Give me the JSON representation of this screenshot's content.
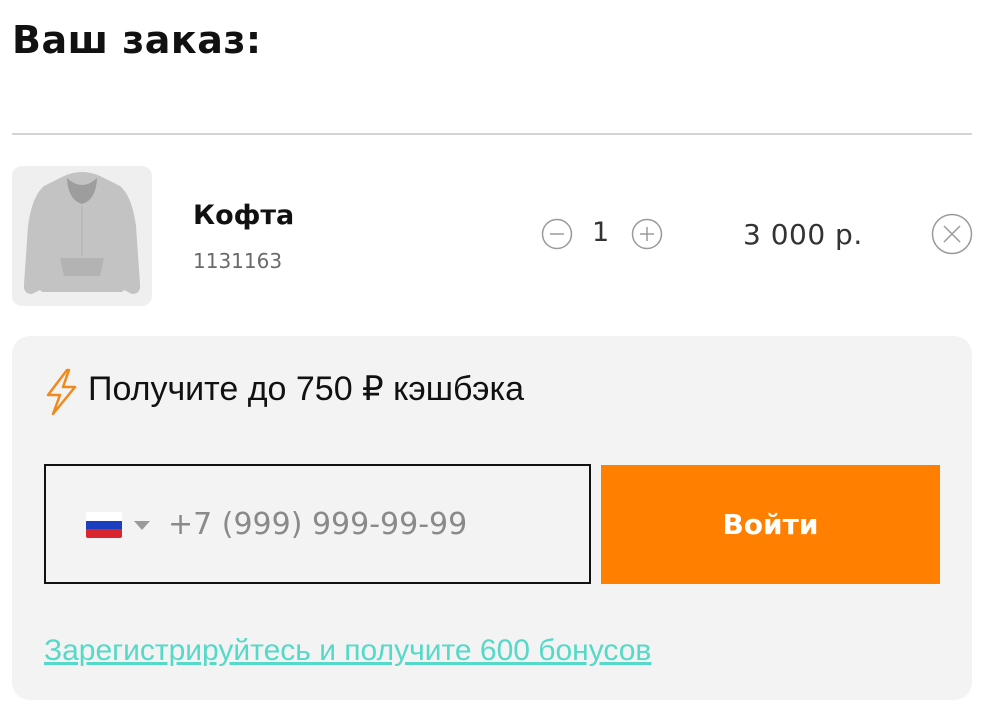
{
  "order": {
    "title": "Ваш заказ:"
  },
  "item": {
    "image_icon": "hoodie-image",
    "name": "Кофта",
    "sku": "1131163",
    "quantity": "1",
    "price": "3 000 р.",
    "minus_icon": "minus-circle-icon",
    "plus_icon": "plus-circle-icon",
    "remove_icon": "close-circle-icon"
  },
  "cashback": {
    "icon": "lightning-icon",
    "text": "Получите до 750 ₽ кэшбэка",
    "country_flag": "russia-flag-icon",
    "phone_placeholder": "+7 (999) 999-99-99",
    "phone_value": "",
    "login_label": "Войти",
    "register_link": "Зарегистрируйтесь и получите 600 бонусов"
  },
  "colors": {
    "accent": "#ff7f00",
    "link": "#55d9c8",
    "panel_bg": "#f3f3f3"
  }
}
